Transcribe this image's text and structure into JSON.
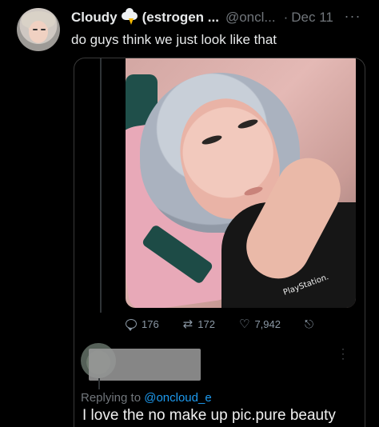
{
  "tweet": {
    "display_name": "Cloudy",
    "name_icon": "cloud-lightning-icon",
    "name_suffix": "(estrogen ...",
    "handle": "@oncl...",
    "separator": "·",
    "date": "Dec 11",
    "more_icon": "more-horizontal-icon",
    "text": "do guys think we just look like that"
  },
  "embedded": {
    "photo_brand_text": "PlayStation.",
    "actions": {
      "replies": "176",
      "retweets": "172",
      "likes": "7,942"
    },
    "reply": {
      "replying_prefix": "Replying to",
      "mention": "@oncloud_e",
      "text": "I love the no make up pic.pure beauty"
    }
  },
  "colors": {
    "background": "#000000",
    "text_primary": "#e7e9ea",
    "text_secondary": "#71767b",
    "accent": "#1d9bf0"
  }
}
